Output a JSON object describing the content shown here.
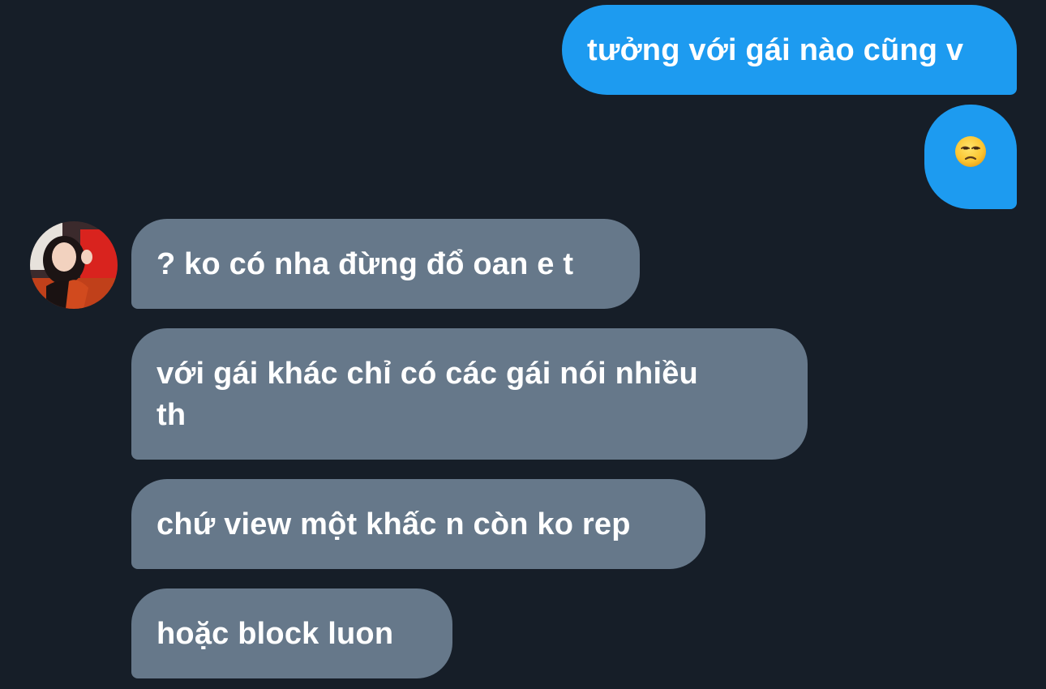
{
  "conversation": {
    "outgoing": [
      {
        "text": "tưởng với gái nào cũng v"
      },
      {
        "text": "😒",
        "icon": "unamused-face-emoji"
      }
    ],
    "incoming": [
      {
        "text": "? ko có nha đừng đổ oan e t"
      },
      {
        "text": "với gái khác chỉ có các gái nói nhiều",
        "text_line2": "th"
      },
      {
        "text": "chứ view một khấc n còn ko rep"
      },
      {
        "text": "hoặc block luon"
      }
    ]
  },
  "colors": {
    "background": "#161e28",
    "outgoing_bubble": "#1d9bf0",
    "incoming_bubble": "#66788a",
    "text": "#ffffff"
  }
}
